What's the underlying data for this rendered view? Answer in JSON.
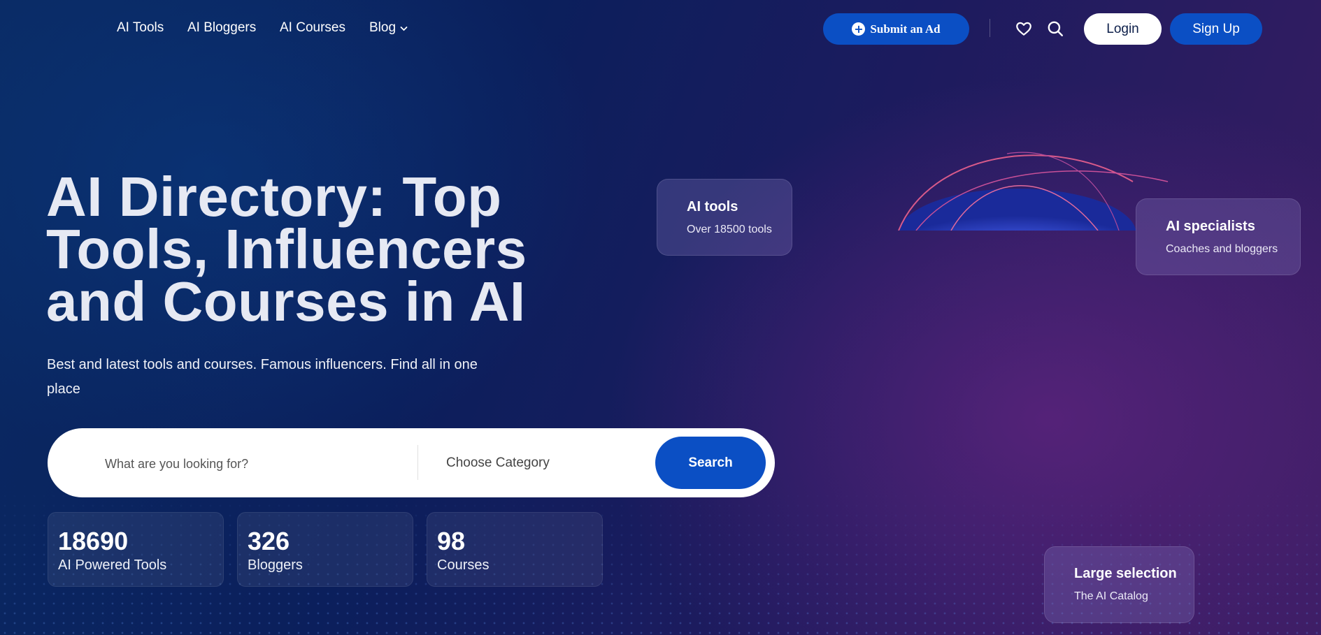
{
  "nav": {
    "links": [
      "AI Tools",
      "AI Bloggers",
      "AI Courses",
      "Blog"
    ],
    "submit_ad": "Submit an Ad",
    "login": "Login",
    "signup": "Sign Up",
    "favorites_icon": "heart-icon",
    "search_icon": "search-icon"
  },
  "hero": {
    "title": "AI Directory: Top Tools, Influencers and Courses in AI",
    "subtitle": "Best and latest tools and courses. Famous influencers. Find all in one place"
  },
  "search": {
    "placeholder": "What are you looking for?",
    "category": "Choose Category",
    "button": "Search"
  },
  "stats": [
    {
      "value": "18690",
      "label": "AI Powered Tools"
    },
    {
      "value": "326",
      "label": "Bloggers"
    },
    {
      "value": "98",
      "label": "Courses"
    }
  ],
  "cards": {
    "tools": {
      "title": "AI tools",
      "subtitle": "Over 18500 tools"
    },
    "specialists": {
      "title": "AI specialists",
      "subtitle": "Coaches and bloggers"
    },
    "selection": {
      "title": "Large selection",
      "subtitle": "The AI Catalog"
    }
  },
  "colors": {
    "accent": "#0b4fc4",
    "background_start": "#0a2a63",
    "background_end": "#3a1d63"
  }
}
